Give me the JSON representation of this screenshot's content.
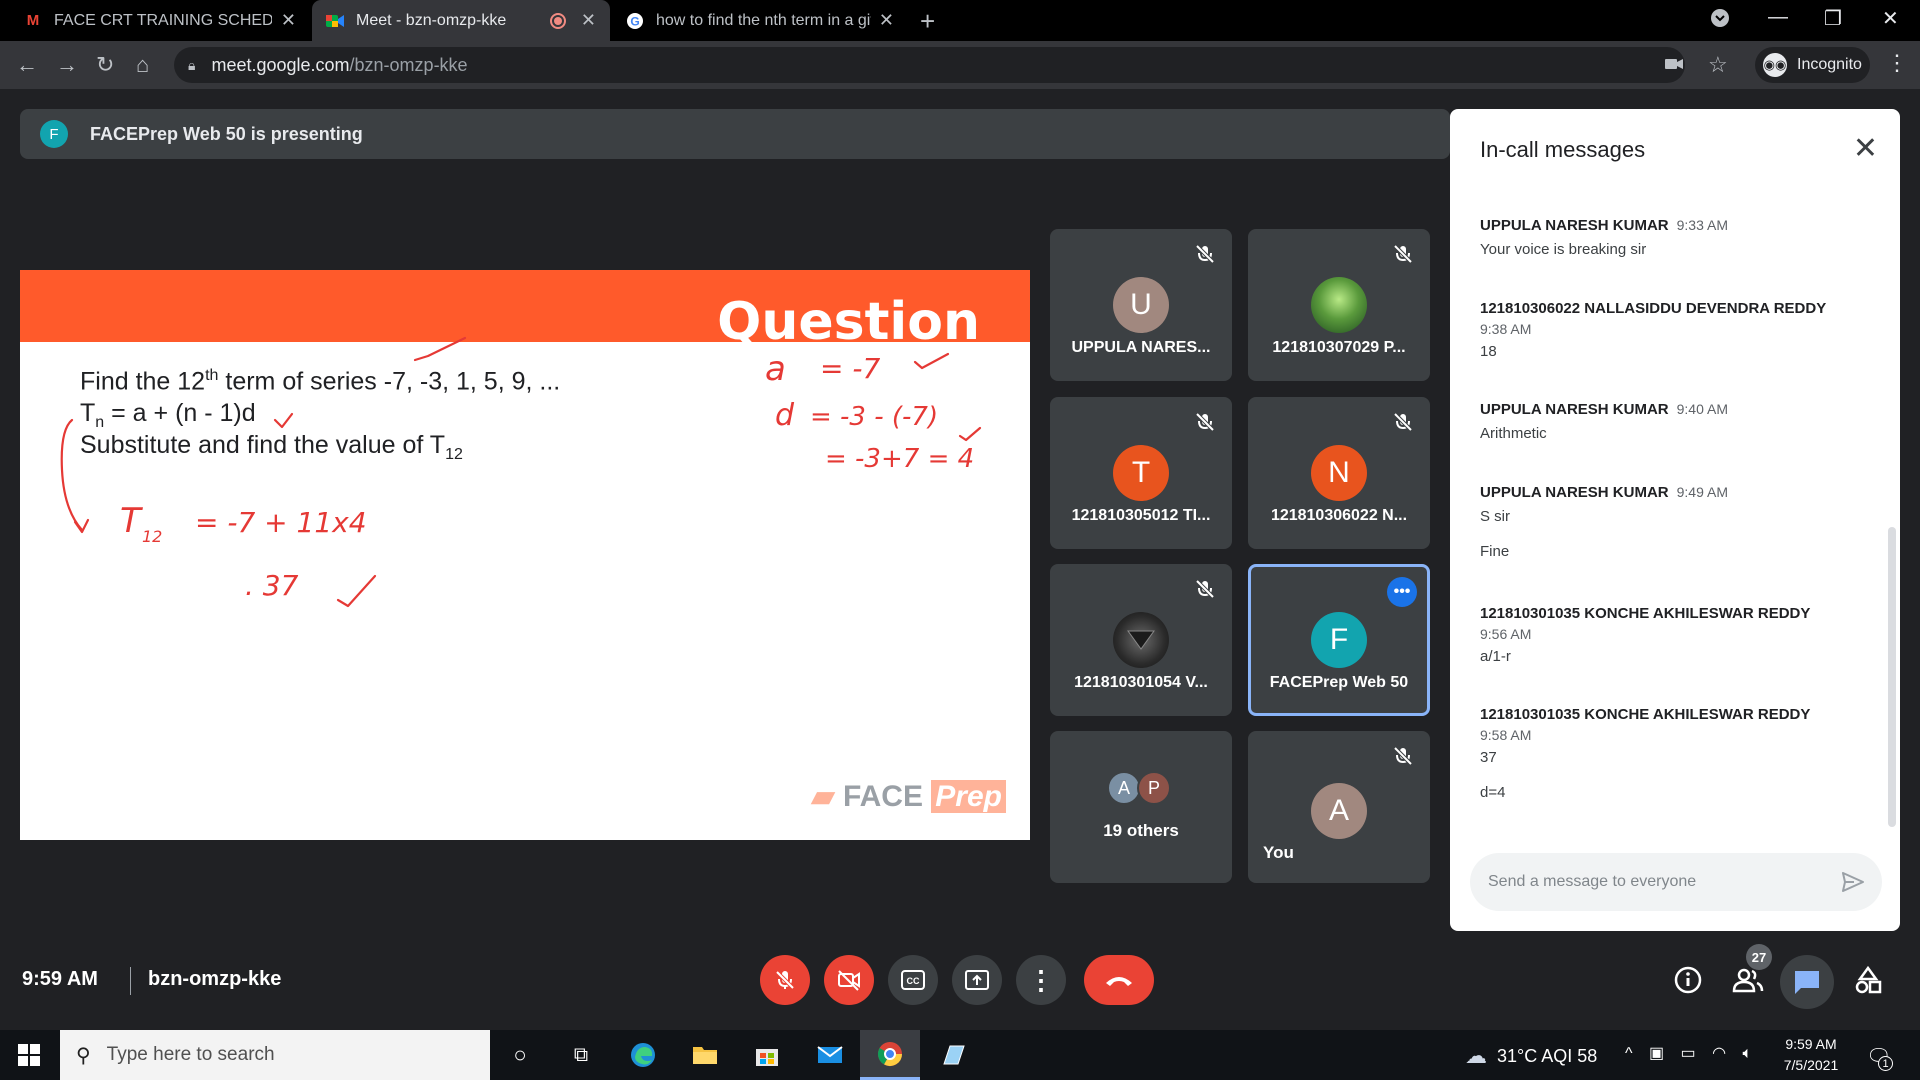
{
  "browser": {
    "tabs": [
      {
        "title": "FACE CRT TRAINING SCHEDULE - ",
        "favicon": "gmail-icon",
        "active": false
      },
      {
        "title": "Meet - bzn-omzp-kke",
        "favicon": "google-meet-icon",
        "active": true,
        "recording": true
      },
      {
        "title": "how to find the nth term in a give",
        "favicon": "google-icon",
        "active": false
      }
    ],
    "url_host": "meet.google.com",
    "url_path": "/bzn-omzp-kke",
    "incognito_label": "Incognito"
  },
  "presenting": {
    "avatar_letter": "F",
    "text": "FACEPrep Web 50 is presenting"
  },
  "slide": {
    "title": "Question",
    "line1_pre": "Find the 12",
    "line1_sup": "th",
    "line1_post": " term of series -7, -3, 1, 5, 9, ...",
    "line2_T": "T",
    "line2_sub": "n",
    "line2_post": " = a + (n - 1)d",
    "line3_pre": "Substitute and find the value of T",
    "line3_sub": "12",
    "logo_face": "FACE",
    "logo_prep": "Prep",
    "annotations": [
      "a = -7",
      "d = -3 - (-7)",
      "= -3+7 = 4",
      "T12 = -7 + 11x4",
      "= 37"
    ]
  },
  "participants": [
    {
      "name": "UPPULA NARES...",
      "avatar_letter": "U",
      "avatar_color": "#a1887f",
      "muted": true
    },
    {
      "name": "121810307029 P...",
      "avatar_letter": "",
      "avatar_color": "#3d7a3a",
      "muted": true,
      "photo": "nature-photo"
    },
    {
      "name": "121810305012 TI...",
      "avatar_letter": "T",
      "avatar_color": "#e8541e",
      "muted": true
    },
    {
      "name": "121810306022 N...",
      "avatar_letter": "N",
      "avatar_color": "#e8541e",
      "muted": true
    },
    {
      "name": "121810301054 V...",
      "avatar_letter": "",
      "avatar_color": "#2b2b2b",
      "muted": true,
      "photo": "superman-logo-photo"
    },
    {
      "name": "FACEPrep Web 50",
      "avatar_letter": "F",
      "avatar_color": "#12a4af",
      "active": true
    },
    {
      "name": "19 others",
      "avatar_letters": [
        "A",
        "P"
      ]
    },
    {
      "name": "You",
      "avatar_letter": "A",
      "avatar_color": "#a1887f",
      "muted": true
    }
  ],
  "chat": {
    "title": "In-call messages",
    "messages": [
      {
        "sender": "UPPULA NARESH KUMAR",
        "time": "9:33 AM",
        "lines": [
          "Your voice is breaking sir"
        ]
      },
      {
        "sender": "121810306022 NALLASIDDU DEVENDRA REDDY",
        "time": "9:38 AM",
        "lines": [
          "18"
        ]
      },
      {
        "sender": "UPPULA NARESH KUMAR",
        "time": "9:40 AM",
        "lines": [
          "Arithmetic"
        ]
      },
      {
        "sender": "UPPULA NARESH KUMAR",
        "time": "9:49 AM",
        "lines": [
          "S sir",
          "Fine"
        ]
      },
      {
        "sender": "121810301035 KONCHE AKHILESWAR REDDY",
        "time": "9:56 AM",
        "lines": [
          "a/1-r"
        ]
      },
      {
        "sender": "121810301035 KONCHE AKHILESWAR REDDY",
        "time": "9:58 AM",
        "lines": [
          "37",
          "d=4"
        ]
      }
    ],
    "input_placeholder": "Send a message to everyone"
  },
  "bottombar": {
    "time": "9:59 AM",
    "meeting_code": "bzn-omzp-kke",
    "people_count": "27"
  },
  "taskbar": {
    "search_placeholder": "Type here to search",
    "weather": "31°C  AQI 58",
    "clock_time": "9:59 AM",
    "clock_date": "7/5/2021",
    "notification_count": "1"
  },
  "colors": {
    "meet_red": "#ea4335",
    "slide_orange": "#ff5a2b",
    "accent_blue": "#8ab4f8"
  }
}
